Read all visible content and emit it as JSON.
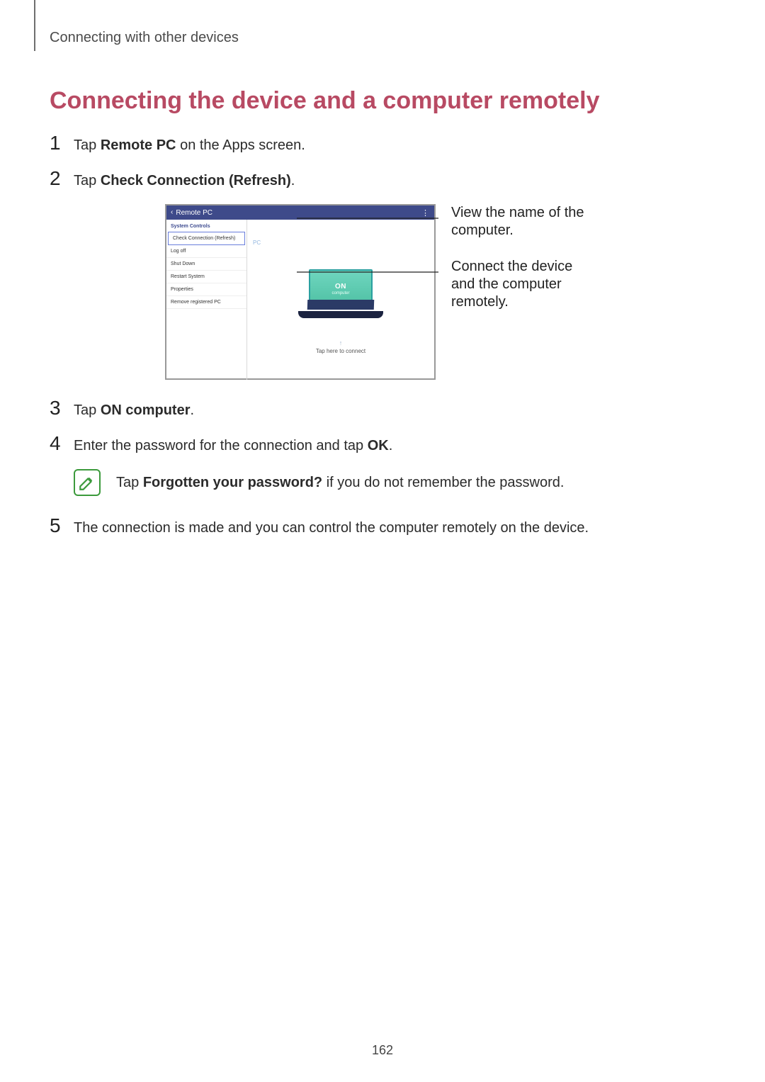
{
  "breadcrumb": "Connecting with other devices",
  "heading": "Connecting the device and a computer remotely",
  "page_number": "162",
  "steps": {
    "s1": {
      "num": "1",
      "pre": "Tap ",
      "bold": "Remote PC",
      "post": " on the Apps screen."
    },
    "s2": {
      "num": "2",
      "pre": "Tap ",
      "bold": "Check Connection (Refresh)",
      "post": "."
    },
    "s3": {
      "num": "3",
      "pre": "Tap ",
      "bold": "ON computer",
      "post": "."
    },
    "s4": {
      "num": "4",
      "pre": "Enter the password for the connection and tap ",
      "bold": "OK",
      "post": "."
    },
    "s5": {
      "num": "5",
      "text": "The connection is made and you can control the computer remotely on the device."
    }
  },
  "note": {
    "pre": "Tap ",
    "bold": "Forgotten your password?",
    "post": " if you do not remember the password."
  },
  "callouts": {
    "c1": "View the name of the computer.",
    "c2": "Connect the device and the computer remotely."
  },
  "mock": {
    "header_title": "Remote PC",
    "sidebar_heading": "System Controls",
    "sidebar_items": [
      "Check Connection (Refresh)",
      "Log off",
      "Shut Down",
      "Restart System",
      "Properties",
      "Remove registered PC"
    ],
    "pc_name": "PC",
    "on_label": "ON",
    "on_sublabel": "computer",
    "tap_hint": "Tap here to connect"
  }
}
